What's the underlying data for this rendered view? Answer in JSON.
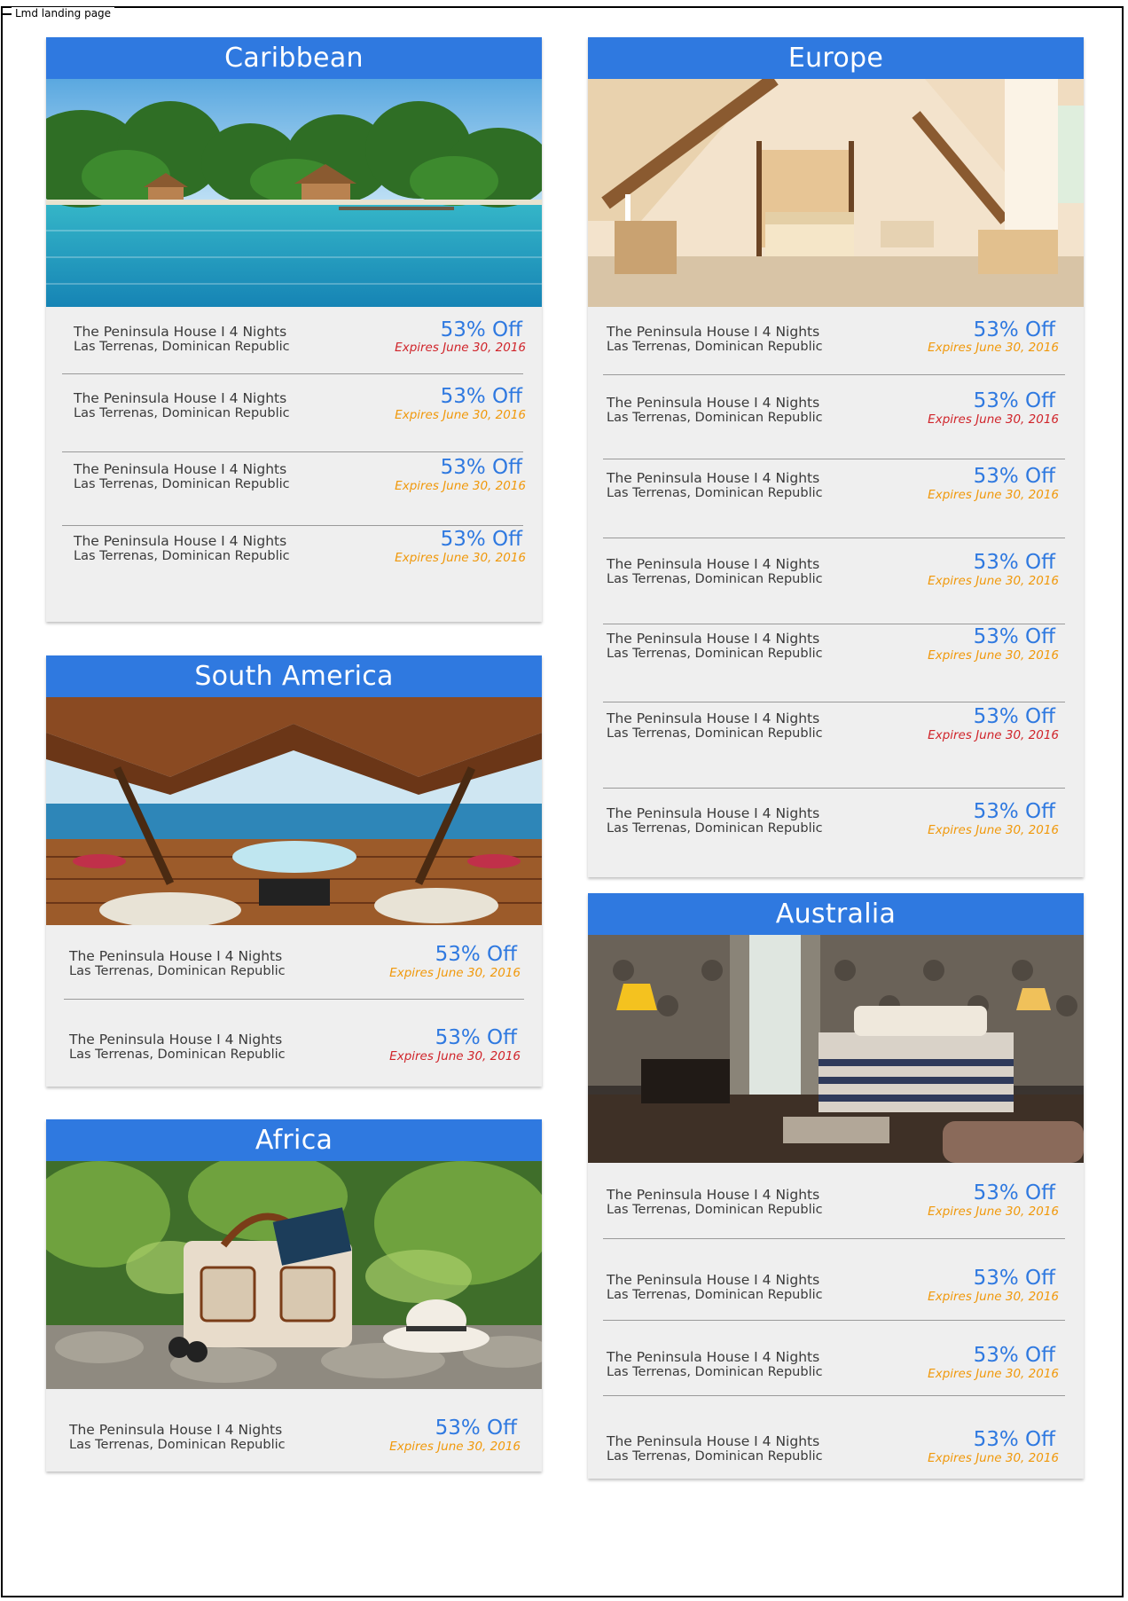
{
  "page": {
    "label": "Lmd landing page"
  },
  "colors": {
    "header_blue": "#2f79e0",
    "expiry_red": "#d0242a",
    "expiry_orange": "#f0980a"
  },
  "deal": {
    "title": "The Peninsula House I 4 Nights",
    "location": "Las Terrenas, Dominican Republic",
    "discount": "53% Off",
    "expiry": "Expires June 30, 2016"
  },
  "cards": {
    "caribbean": {
      "title": "Caribbean",
      "expiry_colors": [
        "red",
        "orange",
        "orange",
        "orange"
      ]
    },
    "south_america": {
      "title": "South America",
      "expiry_colors": [
        "orange",
        "red"
      ]
    },
    "africa": {
      "title": "Africa",
      "expiry_colors": [
        "orange"
      ]
    },
    "europe": {
      "title": "Europe",
      "expiry_colors": [
        "orange",
        "red",
        "orange",
        "orange",
        "orange",
        "red",
        "orange"
      ]
    },
    "australia": {
      "title": "Australia",
      "expiry_colors": [
        "orange",
        "orange",
        "orange",
        "orange"
      ]
    }
  }
}
